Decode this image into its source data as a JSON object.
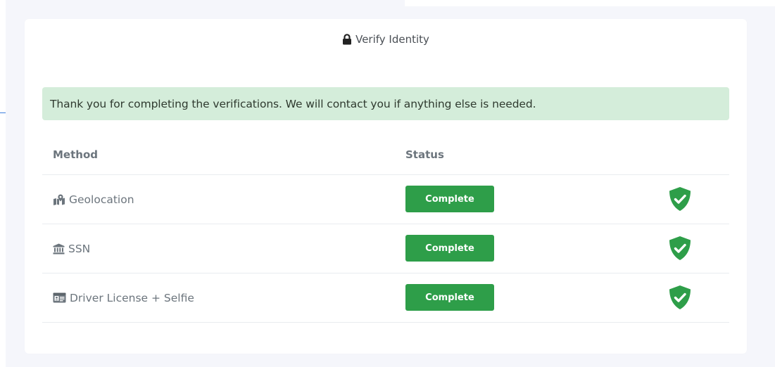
{
  "card": {
    "title": "Verify Identity",
    "title_icon": "lock-icon"
  },
  "alert": {
    "message": "Thank you for completing the verifications. We will contact you if anything else is needed.",
    "color": "#d4edda"
  },
  "table": {
    "columns": {
      "method": "Method",
      "status": "Status"
    },
    "rows": [
      {
        "method": "Geolocation",
        "icon": "map-marked-icon",
        "status": "Complete",
        "status_icon": "shield-check-icon"
      },
      {
        "method": "SSN",
        "icon": "bank-icon",
        "status": "Complete",
        "status_icon": "shield-check-icon"
      },
      {
        "method": "Driver License + Selfie",
        "icon": "id-card-icon",
        "status": "Complete",
        "status_icon": "shield-check-icon"
      }
    ]
  },
  "colors": {
    "success": "#2e9e49",
    "muted_text": "#6c757d"
  }
}
